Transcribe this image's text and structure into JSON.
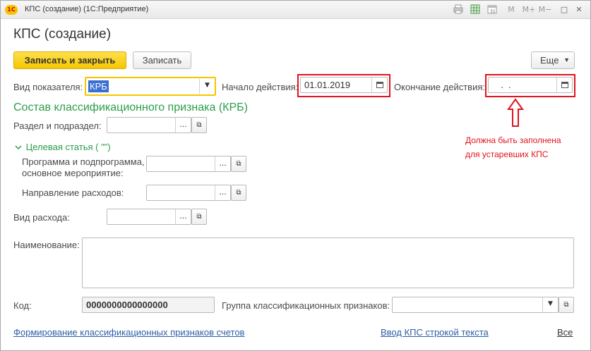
{
  "window": {
    "app_badge": "1С",
    "title": "КПС (создание)  (1С:Предприятие)"
  },
  "titlebar_buttons": {
    "m": "M",
    "m_plus": "M+",
    "m_minus": "M−",
    "restore": "□",
    "close": "✕"
  },
  "form": {
    "heading": "КПС (создание)"
  },
  "toolbar": {
    "save_close": "Записать и закрыть",
    "save": "Записать",
    "more": "Еще"
  },
  "fields": {
    "indicator_type": {
      "label": "Вид показателя:",
      "value": "КРБ"
    },
    "start_date": {
      "label": "Начало действия:",
      "value": "01.01.2019"
    },
    "end_date": {
      "label": "Окончание действия:",
      "value": "  .  ."
    },
    "section_group_title": "Состав классификационного признака (КРБ)",
    "section": {
      "label": "Раздел и подраздел:",
      "value": ""
    },
    "target_item": {
      "label": "Целевая статья ( \"\")"
    },
    "program": {
      "label_line1": "Программа и подпрограмма,",
      "label_line2": "основное мероприятие:",
      "value": ""
    },
    "direction": {
      "label": "Направление расходов:",
      "value": ""
    },
    "expense_type": {
      "label": "Вид расхода:",
      "value": ""
    },
    "name": {
      "label": "Наименование:",
      "value": ""
    },
    "code": {
      "label": "Код:",
      "value": "0000000000000000"
    },
    "group": {
      "label": "Группа классификационных признаков:",
      "value": ""
    }
  },
  "annotation": {
    "line1": "Должна быть заполнена",
    "line2": "для устаревших КПС"
  },
  "links": {
    "form_signs": "Формирование классификационных признаков счетов",
    "enter_text": "Ввод КПС строкой текста",
    "all": "Все"
  },
  "colors": {
    "accent_yellow": "#f6c600",
    "green": "#2a9d49",
    "annotation_red": "#e0141e",
    "link_blue": "#2b5ea8"
  }
}
